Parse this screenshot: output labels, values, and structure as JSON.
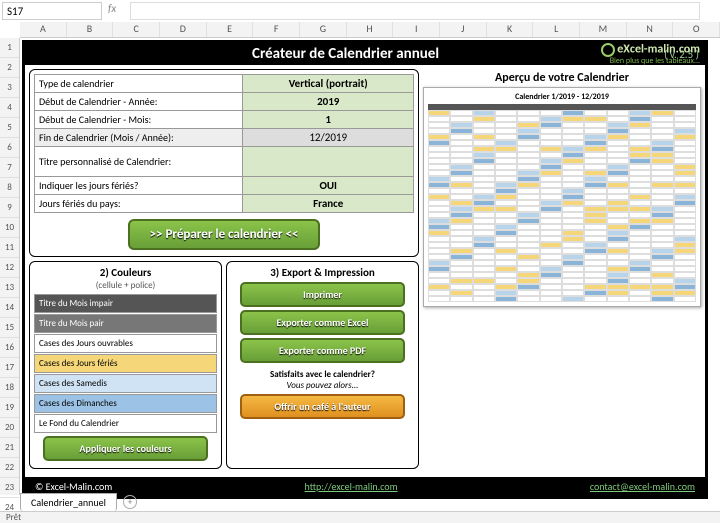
{
  "cellRef": "S17",
  "cols": [
    "A",
    "B",
    "C",
    "D",
    "E",
    "F",
    "G",
    "H",
    "I",
    "J",
    "K",
    "L",
    "M",
    "N",
    "O"
  ],
  "rows": [
    "1",
    "2",
    "3",
    "4",
    "5",
    "6",
    "7",
    "8",
    "9",
    "10",
    "11",
    "12",
    "13",
    "14",
    "15",
    "16",
    "17",
    "18",
    "19",
    "20",
    "21",
    "22",
    "23",
    "24"
  ],
  "title": "Créateur de Calendrier annuel",
  "version": "( v. 2.5 )",
  "brand1": "eXcel-malin.com",
  "brand2": "Bien plus que les tableaux...",
  "cfg": {
    "r1l": "Type de calendrier",
    "r1v": "Vertical (portrait)",
    "r2l": "Début de Calendrier - Année:",
    "r2v": "2019",
    "r3l": "Début de Calendrier - Mois:",
    "r3v": "1",
    "r4l": "Fin de Calendrier (Mois / Année):",
    "r4v": "12/2019",
    "r5l": "Titre personnalisé de Calendrier:",
    "r5v": "",
    "r6l": "Indiquer les jours fériés?",
    "r6v": "OUI",
    "r7l": "Jours fériés du pays:",
    "r7v": "France"
  },
  "prepare": ">>  Préparer le calendrier  <<",
  "colors": {
    "h": "2) Couleurs",
    "sub": "(cellule + police)",
    "c1": "Titre du Mois impair",
    "c2": "Titre du Mois pair",
    "c3": "Cases des Jours ouvrables",
    "c4": "Cases des Jours fériés",
    "c5": "Cases des Samedis",
    "c6": "Cases des Dimanches",
    "c7": "Le Fond du Calendrier",
    "apply": "Appliquer les couleurs"
  },
  "export": {
    "h": "3) Export & Impression",
    "print": "Imprimer",
    "xls": "Exporter comme Excel",
    "pdf": "Exporter comme PDF",
    "sat1": "Satisfaits avec le calendrier?",
    "sat2": "Vous pouvez alors...",
    "coffee": "Offrir un café à l'auteur"
  },
  "preview": {
    "h": "Aperçu de votre Calendrier",
    "title": "Calendrier 1/2019 - 12/2019"
  },
  "footer": {
    "copy": "©  Excel-Malin.com",
    "link": "http://excel-malin.com",
    "mail": "contact@excel-malin.com"
  },
  "tab": "Calendrier_annuel",
  "status": "Prêt"
}
